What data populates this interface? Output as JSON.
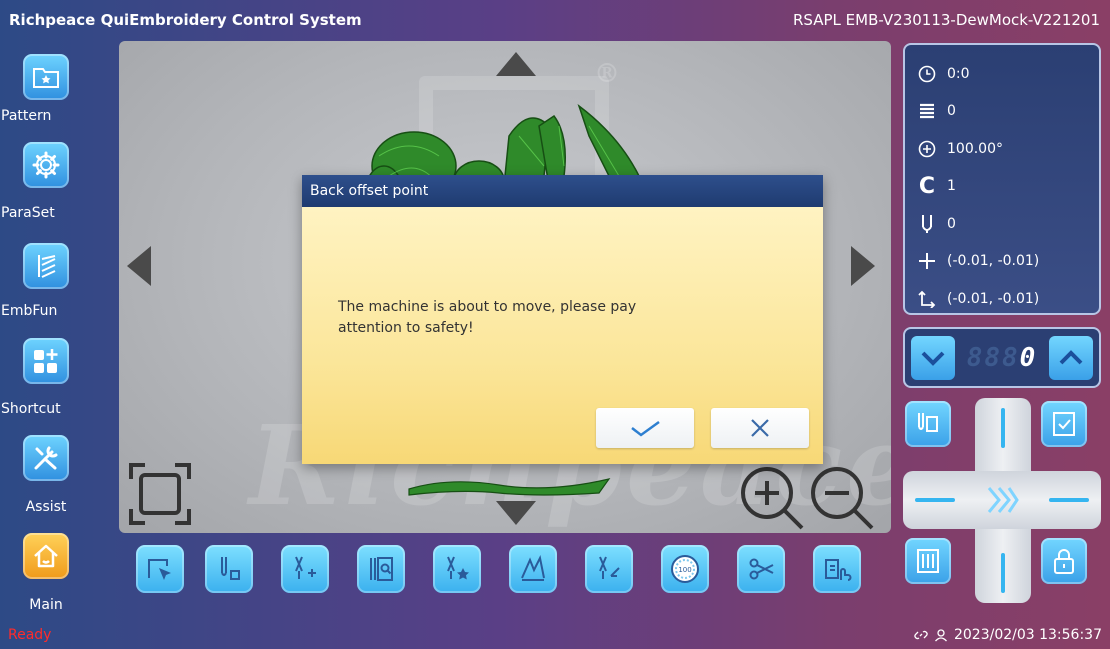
{
  "title": {
    "app_name": "Richpeace QuiEmbroidery Control System",
    "version": "RSAPL EMB-V230113-DewMock-V221201"
  },
  "sidebar": {
    "items": [
      {
        "label": "Pattern",
        "icon": "folder-star-icon"
      },
      {
        "label": "ParaSet",
        "icon": "gear-icon"
      },
      {
        "label": "EmbFun",
        "icon": "stitch-lines-icon"
      },
      {
        "label": "Shortcut",
        "icon": "grid-plus-icon"
      },
      {
        "label": "Assist",
        "icon": "wrench-screwdriver-icon"
      },
      {
        "label": "Main",
        "icon": "home-icon"
      }
    ]
  },
  "info_panel": {
    "time": "0:0",
    "stitch_count": "0",
    "angle": "100.00°",
    "c_value": "1",
    "needle": "0",
    "position": "(-0.01, -0.01)",
    "origin_position": "(-0.01, -0.01)"
  },
  "counter": {
    "dim_digits": "888",
    "value": "0"
  },
  "dialog": {
    "title": "Back offset point",
    "message": "The machine is about to move, please pay attention to safety!",
    "confirm_icon": "check-icon",
    "cancel_icon": "close-icon"
  },
  "toolbar": {
    "items": [
      "select-cursor-icon",
      "needle-stitch-icon",
      "needle-add-icon",
      "frame-search-icon",
      "needle-star-icon",
      "stitch-edit-icon",
      "needle-back-icon",
      "speed-gauge-icon",
      "scissors-icon",
      "copy-touch-icon"
    ]
  },
  "status": {
    "state": "Ready",
    "datetime": "2023/02/03 13:56:37"
  },
  "colors": {
    "accent_blue": "#3aa0e8",
    "dialog_header": "#1f3b70",
    "dialog_body": "#fbe69a",
    "status_ready": "#ff2b2b"
  }
}
